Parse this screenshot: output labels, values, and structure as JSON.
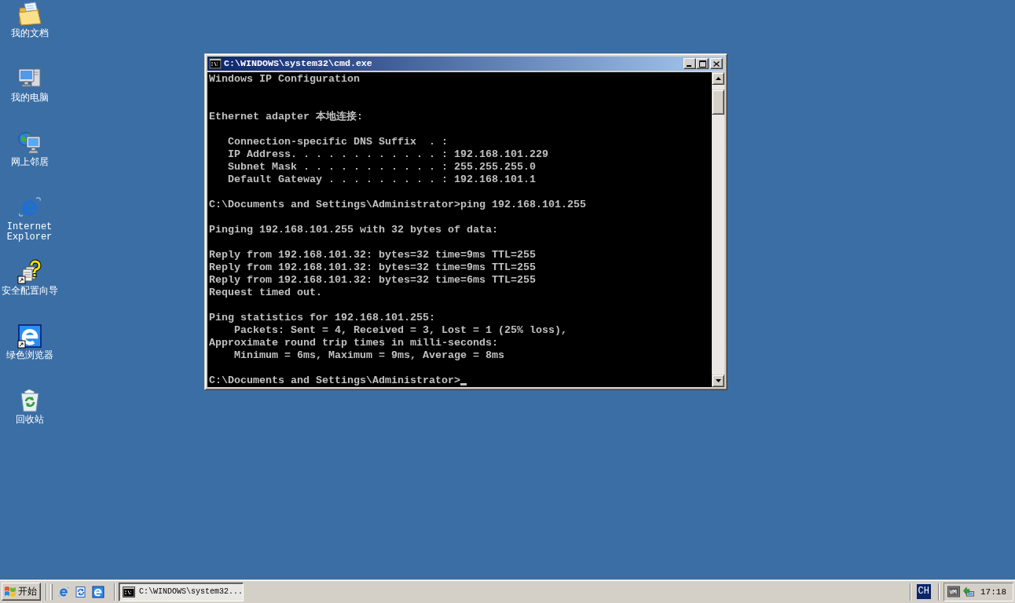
{
  "desktop_icons": [
    {
      "label": "我的文档",
      "kind": "folder",
      "shortcut": false
    },
    {
      "label": "我的电脑",
      "kind": "computer",
      "shortcut": false
    },
    {
      "label": "网上邻居",
      "kind": "network",
      "shortcut": false
    },
    {
      "label": "Internet Explorer",
      "kind": "globe",
      "shortcut": false
    },
    {
      "label": "安全配置向导",
      "kind": "wizard",
      "shortcut": true
    },
    {
      "label": "绿色浏览器",
      "kind": "tile",
      "shortcut": true
    },
    {
      "label": "回收站",
      "kind": "bin",
      "shortcut": false
    }
  ],
  "window": {
    "title": "C:\\WINDOWS\\system32\\cmd.exe",
    "active": true
  },
  "console": {
    "lines": [
      {
        "kind": "text",
        "text": "Windows IP Configuration"
      },
      {
        "kind": "blank"
      },
      {
        "kind": "blank"
      },
      {
        "kind": "text",
        "text": "Ethernet adapter 本地连接:"
      },
      {
        "kind": "blank"
      },
      {
        "kind": "field",
        "text": "Connection-specific DNS Suffix  . :"
      },
      {
        "kind": "field",
        "text": "IP Address. . . . . . . . . . . . : 192.168.101.229"
      },
      {
        "kind": "field",
        "text": "Subnet Mask . . . . . . . . . . . : 255.255.255.0"
      },
      {
        "kind": "field",
        "text": "Default Gateway . . . . . . . . . : 192.168.101.1"
      },
      {
        "kind": "blank"
      },
      {
        "kind": "text",
        "text": "C:\\Documents and Settings\\Administrator>ping 192.168.101.255"
      },
      {
        "kind": "blank"
      },
      {
        "kind": "text",
        "text": "Pinging 192.168.101.255 with 32 bytes of data:"
      },
      {
        "kind": "blank"
      },
      {
        "kind": "text",
        "text": "Reply from 192.168.101.32: bytes=32 time=9ms TTL=255"
      },
      {
        "kind": "text",
        "text": "Reply from 192.168.101.32: bytes=32 time=9ms TTL=255"
      },
      {
        "kind": "text",
        "text": "Reply from 192.168.101.32: bytes=32 time=6ms TTL=255"
      },
      {
        "kind": "text",
        "text": "Request timed out."
      },
      {
        "kind": "blank"
      },
      {
        "kind": "text",
        "text": "Ping statistics for 192.168.101.255:"
      },
      {
        "kind": "stat",
        "text": "Packets: Sent = 4, Received = 3, Lost = 1 (25% loss),"
      },
      {
        "kind": "text",
        "text": "Approximate round trip times in milli-seconds:"
      },
      {
        "kind": "stat",
        "text": "Minimum = 6ms, Maximum = 9ms, Average = 8ms"
      },
      {
        "kind": "blank"
      },
      {
        "kind": "text",
        "text": "C:\\Documents and Settings\\Administrator>"
      }
    ],
    "cursor": true
  },
  "taskbar": {
    "start": "开始",
    "tasks": [
      {
        "label": "C:\\WINDOWS\\system32...",
        "selected": true
      }
    ],
    "language": "CH",
    "clock": "17:18"
  }
}
